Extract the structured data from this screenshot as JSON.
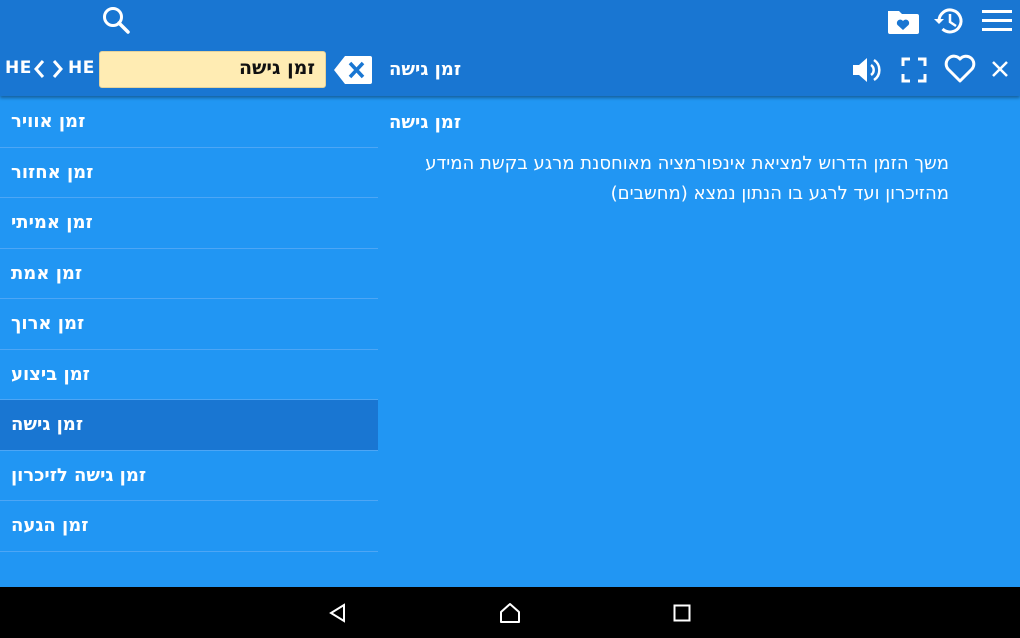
{
  "header": {
    "source_lang": "HE",
    "target_lang": "HE",
    "search_value": "זמן גישה",
    "current_word": "זמן גישה"
  },
  "icons": {
    "search": "search-icon",
    "favorites_folder": "favorites-folder-icon",
    "history": "history-icon",
    "menu": "menu-icon",
    "clear": "backspace-clear-icon",
    "speaker": "speaker-icon",
    "fullscreen": "fullscreen-icon",
    "favorite": "heart-icon",
    "close": "close-icon"
  },
  "word_list": [
    {
      "label": "זמן אוויר"
    },
    {
      "label": "זמן אחזור"
    },
    {
      "label": "זמן אמיתי"
    },
    {
      "label": "זמן אמת"
    },
    {
      "label": "זמן ארוך"
    },
    {
      "label": "זמן ביצוע"
    },
    {
      "label": "זמן גישה",
      "selected": true
    },
    {
      "label": "זמן גישה לזיכרון"
    },
    {
      "label": "זמן הגעה"
    }
  ],
  "definition": {
    "title": "זמן גישה",
    "text": "משך הזמן הדרוש למציאת אינפורמציה מאוחסנת מרגע בקשת המידע מהזיכרון ועד לרגע בו הנתון נמצא (מחשבים)"
  },
  "colors": {
    "toolbar": "#1976D2",
    "background": "#2196F3",
    "search_field": "#FFECB3",
    "selected_row": "#1976D2"
  }
}
